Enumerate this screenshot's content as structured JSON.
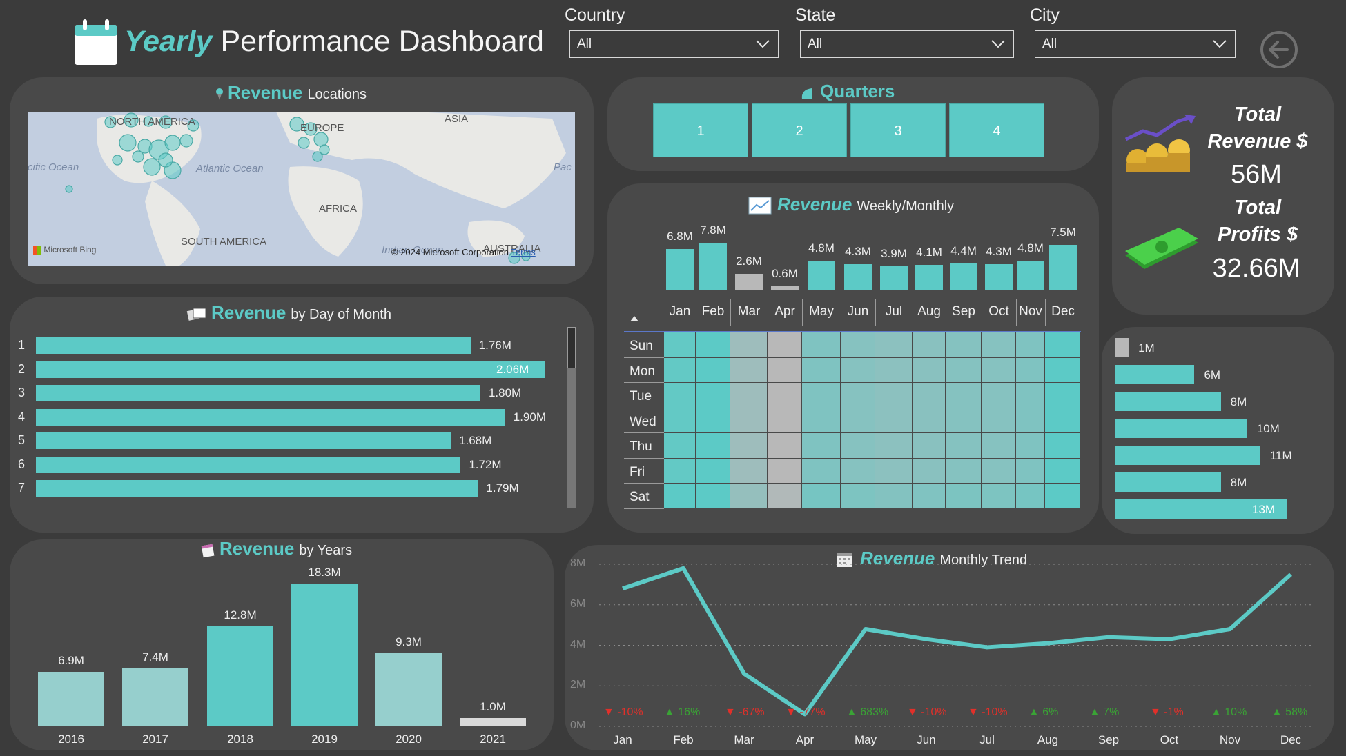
{
  "header": {
    "title_bold": "Yearly",
    "title_rest": "Performance Dashboard"
  },
  "filters": [
    {
      "label": "Country",
      "value": "All"
    },
    {
      "label": "State",
      "value": "All"
    },
    {
      "label": "City",
      "value": "All"
    }
  ],
  "map_panel": {
    "title_bold": "Revenue",
    "title_rest": "Locations",
    "labels": {
      "north_america": "NORTH AMERICA",
      "europe": "EUROPE",
      "asia": "ASIA",
      "pacific": "cific Ocean",
      "atlantic": "Atlantic Ocean",
      "pac": "Pac",
      "africa": "AFRICA",
      "south_america": "SOUTH AMERICA",
      "indian": "Indian Ocean",
      "australia": "AUSTRALIA"
    },
    "bing": "Microsoft Bing",
    "copyright": "© 2024 Microsoft Corporation",
    "terms": "Terms"
  },
  "quarters_panel": {
    "title": "Quarters",
    "buttons": [
      "1",
      "2",
      "3",
      "4"
    ]
  },
  "kpis": {
    "revenue_label_1": "Total",
    "revenue_label_2": "Revenue $",
    "revenue_value": "56M",
    "profit_label_1": "Total",
    "profit_label_2": "Profits $",
    "profit_value": "32.66M"
  },
  "day_of_month_panel": {
    "title_bold": "Revenue",
    "title_rest": "by Day of Month",
    "rows": [
      {
        "day": "1",
        "value": 1.76,
        "label": "1.76M"
      },
      {
        "day": "2",
        "value": 2.06,
        "label": "2.06M"
      },
      {
        "day": "3",
        "value": 1.8,
        "label": "1.80M"
      },
      {
        "day": "4",
        "value": 1.9,
        "label": "1.90M"
      },
      {
        "day": "5",
        "value": 1.68,
        "label": "1.68M"
      },
      {
        "day": "6",
        "value": 1.72,
        "label": "1.72M"
      },
      {
        "day": "7",
        "value": 1.79,
        "label": "1.79M"
      }
    ]
  },
  "weekly_monthly_panel": {
    "title_bold": "Revenue",
    "title_rest": "Weekly/Monthly",
    "months": [
      "Jan",
      "Feb",
      "Mar",
      "Apr",
      "May",
      "Jun",
      "Jul",
      "Aug",
      "Sep",
      "Oct",
      "Nov",
      "Dec"
    ],
    "month_values": [
      6.8,
      7.8,
      2.6,
      0.6,
      4.8,
      4.3,
      3.9,
      4.1,
      4.4,
      4.3,
      4.8,
      7.5
    ],
    "month_labels": [
      "6.8M",
      "7.8M",
      "2.6M",
      "0.6M",
      "4.8M",
      "4.3M",
      "3.9M",
      "4.1M",
      "4.4M",
      "4.3M",
      "4.8M",
      "7.5M"
    ],
    "days": [
      "Sun",
      "Mon",
      "Tue",
      "Wed",
      "Thu",
      "Fri",
      "Sat"
    ]
  },
  "right_bars": [
    {
      "value": 1,
      "label": "1M"
    },
    {
      "value": 6,
      "label": "6M"
    },
    {
      "value": 8,
      "label": "8M"
    },
    {
      "value": 10,
      "label": "10M"
    },
    {
      "value": 11,
      "label": "11M"
    },
    {
      "value": 8,
      "label": "8M"
    },
    {
      "value": 13,
      "label": "13M"
    }
  ],
  "years_panel": {
    "title_bold": "Revenue",
    "title_rest": "by Years",
    "years": [
      "2016",
      "2017",
      "2018",
      "2019",
      "2020",
      "2021"
    ],
    "values": [
      6.9,
      7.4,
      12.8,
      18.3,
      9.3,
      1.0
    ],
    "labels": [
      "6.9M",
      "7.4M",
      "12.8M",
      "18.3M",
      "9.3M",
      "1.0M"
    ]
  },
  "trend_panel": {
    "title_bold": "Revenue",
    "title_rest": "Monthly Trend",
    "y_ticks": [
      "8M",
      "6M",
      "4M",
      "2M",
      "0M"
    ],
    "months": [
      "Jan",
      "Feb",
      "Mar",
      "Apr",
      "May",
      "Jun",
      "Jul",
      "Aug",
      "Sep",
      "Oct",
      "Nov",
      "Dec"
    ],
    "changes": [
      "-10%",
      "16%",
      "-67%",
      "-77%",
      "683%",
      "-10%",
      "-10%",
      "6%",
      "7%",
      "-1%",
      "10%",
      "58%"
    ],
    "directions": [
      "down",
      "up",
      "down",
      "down",
      "up",
      "down",
      "down",
      "up",
      "up",
      "down",
      "up",
      "up"
    ]
  },
  "chart_data": [
    {
      "type": "bar",
      "title": "Revenue by Day of Month",
      "categories": [
        "1",
        "2",
        "3",
        "4",
        "5",
        "6",
        "7"
      ],
      "values": [
        1.76,
        2.06,
        1.8,
        1.9,
        1.68,
        1.72,
        1.79
      ]
    },
    {
      "type": "bar",
      "title": "Revenue Weekly/Monthly",
      "categories": [
        "Jan",
        "Feb",
        "Mar",
        "Apr",
        "May",
        "Jun",
        "Jul",
        "Aug",
        "Sep",
        "Oct",
        "Nov",
        "Dec"
      ],
      "values": [
        6.8,
        7.8,
        2.6,
        0.6,
        4.8,
        4.3,
        3.9,
        4.1,
        4.4,
        4.3,
        4.8,
        7.5
      ]
    },
    {
      "type": "bar",
      "title": "Revenue by Years",
      "categories": [
        "2016",
        "2017",
        "2018",
        "2019",
        "2020",
        "2021"
      ],
      "values": [
        6.9,
        7.4,
        12.8,
        18.3,
        9.3,
        1.0
      ]
    },
    {
      "type": "bar",
      "categories": [
        "1M",
        "6M",
        "8M",
        "10M",
        "11M",
        "8M",
        "13M"
      ],
      "values": [
        1,
        6,
        8,
        10,
        11,
        8,
        13
      ]
    },
    {
      "type": "line",
      "title": "Revenue Monthly Trend",
      "x": [
        "Jan",
        "Feb",
        "Mar",
        "Apr",
        "May",
        "Jun",
        "Jul",
        "Aug",
        "Sep",
        "Oct",
        "Nov",
        "Dec"
      ],
      "values": [
        6.8,
        7.8,
        2.6,
        0.6,
        4.8,
        4.3,
        3.9,
        4.1,
        4.4,
        4.3,
        4.8,
        7.5
      ],
      "ylim": [
        0,
        8
      ],
      "grid": true
    }
  ]
}
